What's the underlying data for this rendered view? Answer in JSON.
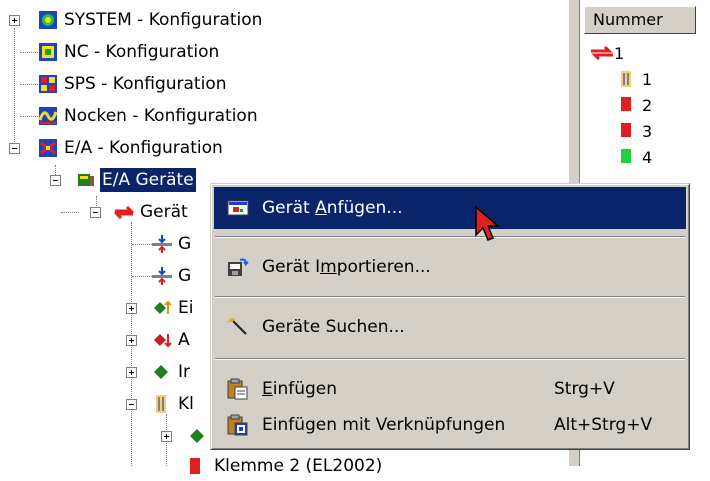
{
  "tree": {
    "system": "SYSTEM - Konfiguration",
    "nc": "NC - Konfiguration",
    "sps": "SPS - Konfiguration",
    "nocken": "Nocken - Konfiguration",
    "ea": "E/A - Konfiguration",
    "ea_geraete": "E/A Geräte",
    "geraet1": "Gerät",
    "child_g1": "G",
    "child_g2": "G",
    "child_ei": "Ei",
    "child_a": "A",
    "child_ir": "Ir",
    "child_kl": "Kl",
    "child_last": "Klemme 2 (EL2002)"
  },
  "right": {
    "header": "Nummer",
    "rows": [
      "1",
      "1",
      "2",
      "3",
      "4"
    ]
  },
  "menu": {
    "item1": {
      "pre": "Gerät ",
      "acc": "A",
      "post": "nfügen..."
    },
    "item2": {
      "pre": "Gerät I",
      "acc": "m",
      "post": "portieren..."
    },
    "item3": {
      "label": "Geräte Suchen..."
    },
    "item4": {
      "pre": "",
      "acc": "E",
      "post": "infügen",
      "shortcut": "Strg+V"
    },
    "item5": {
      "label": "Einfügen mit Verknüpfungen",
      "shortcut": "Alt+Strg+V"
    }
  },
  "icons": {
    "system": "system-config-icon",
    "nc": "nc-config-icon",
    "sps": "plc-config-icon",
    "nocken": "cam-config-icon",
    "ea": "io-config-icon",
    "devices": "io-devices-icon",
    "device": "device-icon",
    "add_device": "add-device-icon",
    "import": "import-icon",
    "wand": "wand-icon",
    "paste": "paste-icon",
    "paste_link": "paste-link-icon",
    "cursor": "mouse-cursor-icon"
  }
}
